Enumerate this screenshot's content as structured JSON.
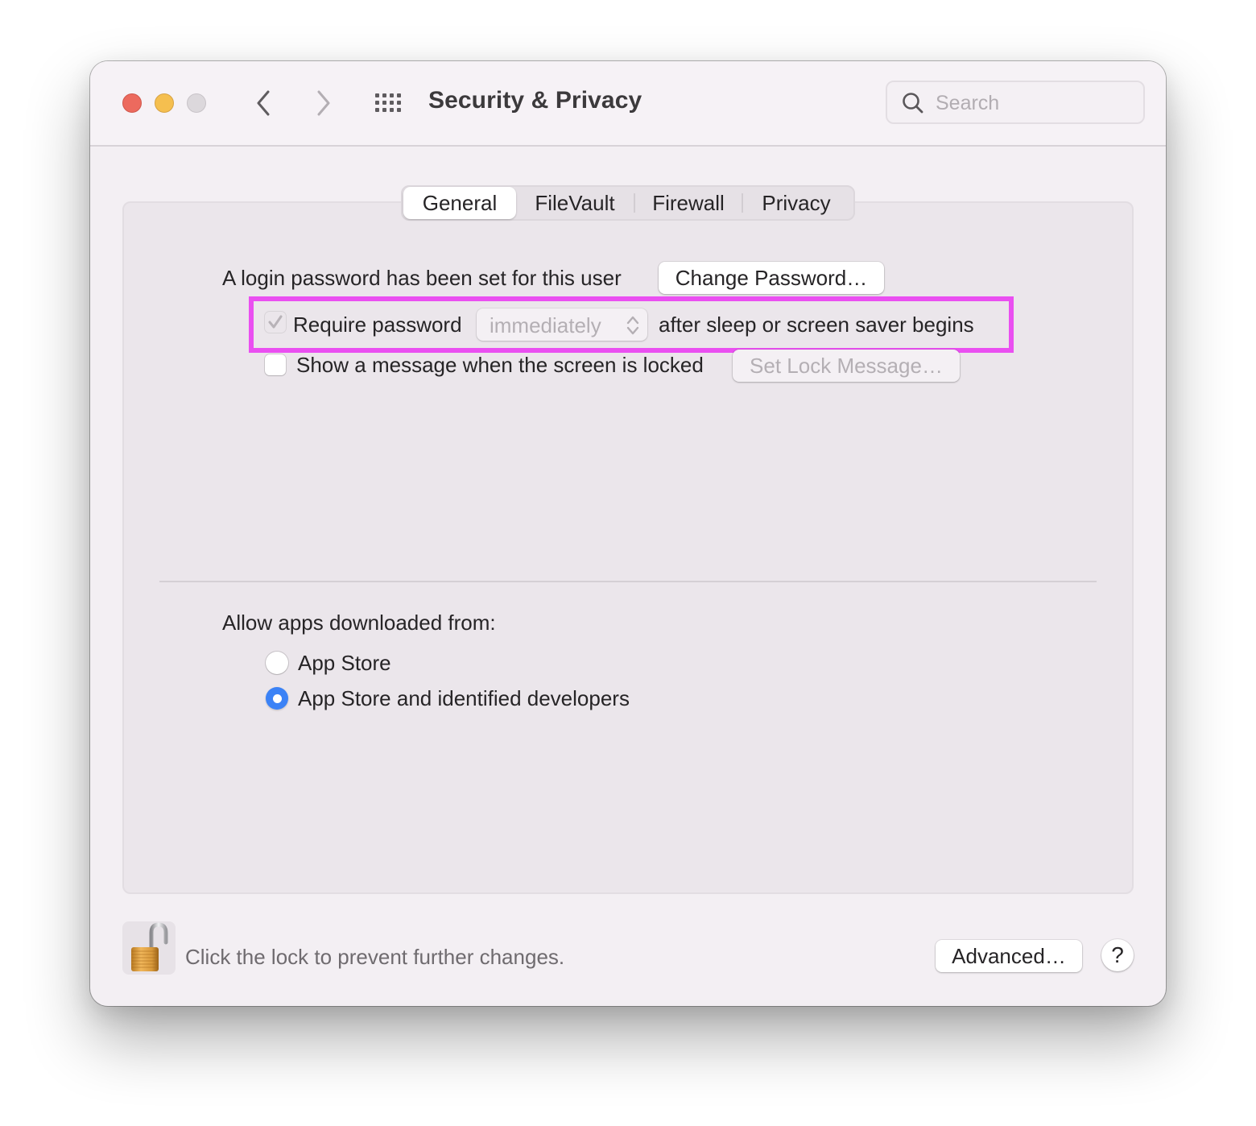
{
  "window": {
    "title": "Security & Privacy",
    "traffic_lights": {
      "close": "close-button",
      "minimize": "minimize-button",
      "zoom": "zoom-button-disabled"
    },
    "nav": {
      "back_icon": "chevron-left-icon",
      "forward_icon": "chevron-right-icon",
      "show_all_icon": "grid-icon"
    },
    "search": {
      "placeholder": "Search",
      "value": "",
      "icon": "magnifier-icon"
    }
  },
  "tabs": [
    {
      "label": "General",
      "active": true
    },
    {
      "label": "FileVault",
      "active": false
    },
    {
      "label": "Firewall",
      "active": false
    },
    {
      "label": "Privacy",
      "active": false
    }
  ],
  "general": {
    "login_password_text": "A login password has been set for this user",
    "change_password_button": "Change Password…",
    "require_password": {
      "label": "Require password",
      "checked": true,
      "enabled": false,
      "delay_selected": "immediately",
      "suffix": "after sleep or screen saver begins"
    },
    "lock_message": {
      "label": "Show a message when the screen is locked",
      "checked": false,
      "button": "Set Lock Message…",
      "button_enabled": false
    },
    "allow_apps": {
      "heading": "Allow apps downloaded from:",
      "options": [
        {
          "label": "App Store",
          "selected": false
        },
        {
          "label": "App Store and identified developers",
          "selected": true
        }
      ]
    }
  },
  "footer": {
    "lock_icon": "unlocked-padlock-icon",
    "lock_text": "Click the lock to prevent further changes.",
    "advanced_button": "Advanced…",
    "help_button": "?"
  },
  "annotation": {
    "highlight_color": "#ea4ff1",
    "highlight_target": "require-password-row"
  },
  "colors": {
    "accent": "#3b82f6",
    "close": "#ec6a5e",
    "minimize": "#f5bf4f",
    "zoom_disabled": "#dcd8dc"
  }
}
